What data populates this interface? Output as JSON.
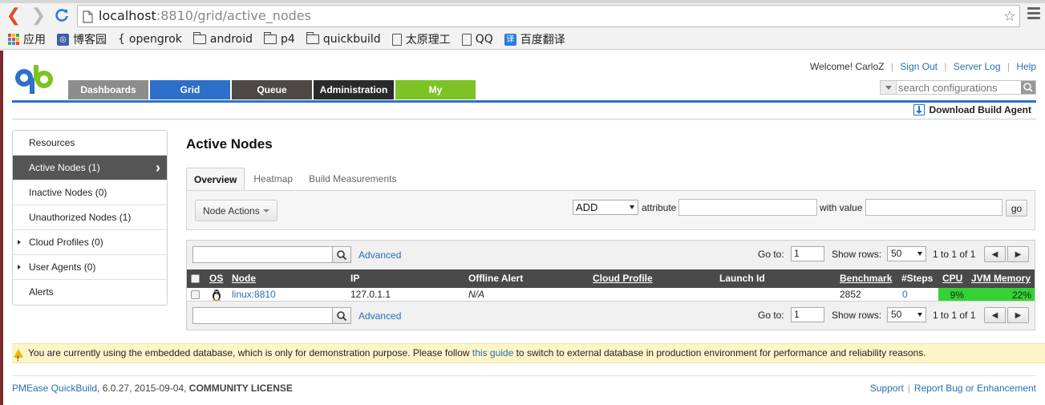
{
  "browser": {
    "url_host": "localhost",
    "url_rest": ":8810/grid/active_nodes",
    "bookmarks": [
      {
        "label": "应用",
        "icon": "apps-grid-icon"
      },
      {
        "label": "博客园",
        "icon": "cnblogs-icon"
      },
      {
        "label": "opengrok",
        "icon": "opengrok-icon"
      },
      {
        "label": "android",
        "icon": "folder-icon"
      },
      {
        "label": "p4",
        "icon": "folder-icon"
      },
      {
        "label": "quickbuild",
        "icon": "folder-icon"
      },
      {
        "label": "太原理工",
        "icon": "page-icon"
      },
      {
        "label": "QQ",
        "icon": "page-icon"
      },
      {
        "label": "百度翻译",
        "icon": "baidu-translate-icon"
      }
    ]
  },
  "header": {
    "welcome": "Welcome! CarloZ",
    "links": [
      "Sign Out",
      "Server Log",
      "Help"
    ],
    "search_placeholder": "search configurations",
    "download_agent": "Download Build Agent"
  },
  "tabs": [
    "Dashboards",
    "Grid",
    "Queue",
    "Administration",
    "My"
  ],
  "sidebar": {
    "items": [
      {
        "label": "Resources"
      },
      {
        "label": "Active Nodes (1)"
      },
      {
        "label": "Inactive Nodes (0)"
      },
      {
        "label": "Unauthorized Nodes (1)"
      },
      {
        "label": "Cloud Profiles (0)"
      },
      {
        "label": "User Agents (0)"
      },
      {
        "label": "Alerts"
      }
    ]
  },
  "main": {
    "title": "Active Nodes",
    "subtabs": [
      "Overview",
      "Heatmap",
      "Build Measurements"
    ],
    "node_actions": "Node Actions",
    "filter_op": "ADD",
    "attribute_label": "attribute",
    "with_value_label": "with value",
    "go_label": "go"
  },
  "grid": {
    "advanced": "Advanced",
    "goto_label": "Go to:",
    "goto_value": "1",
    "show_rows_label": "Show rows:",
    "show_rows_value": "50",
    "range": "1 to 1 of 1",
    "columns": {
      "os": "OS",
      "node": "Node",
      "ip": "IP",
      "offline_alert": "Offline Alert",
      "cloud_profile": "Cloud Profile",
      "launch_id": "Launch Id",
      "benchmark": "Benchmark",
      "steps": "#Steps",
      "cpu": "CPU",
      "jvm": "JVM Memory"
    },
    "rows": [
      {
        "os_icon": "linux-penguin-icon",
        "node": "linux:8810",
        "ip": "127.0.1.1",
        "offline_alert": "N/A",
        "cloud_profile": "",
        "launch_id": "",
        "benchmark": "2852",
        "steps": "0",
        "cpu": "9%",
        "jvm": "22%"
      }
    ]
  },
  "warning": {
    "before": "You are currently using the embedded database, which is only for demonstration purpose. Please follow ",
    "link": "this guide",
    "after": " to switch to external database in production environment for performance and reliability reasons."
  },
  "footer": {
    "product": "PMEase QuickBuild",
    "version": ", 6.0.27, 2015-09-04, ",
    "license": "COMMUNITY LICENSE",
    "links": [
      "Support",
      "Report Bug or Enhancement"
    ]
  },
  "colors": {
    "accent": "#2e70c9",
    "cpu_bar": "#35d235",
    "warning_bg": "#fdf5c7"
  }
}
